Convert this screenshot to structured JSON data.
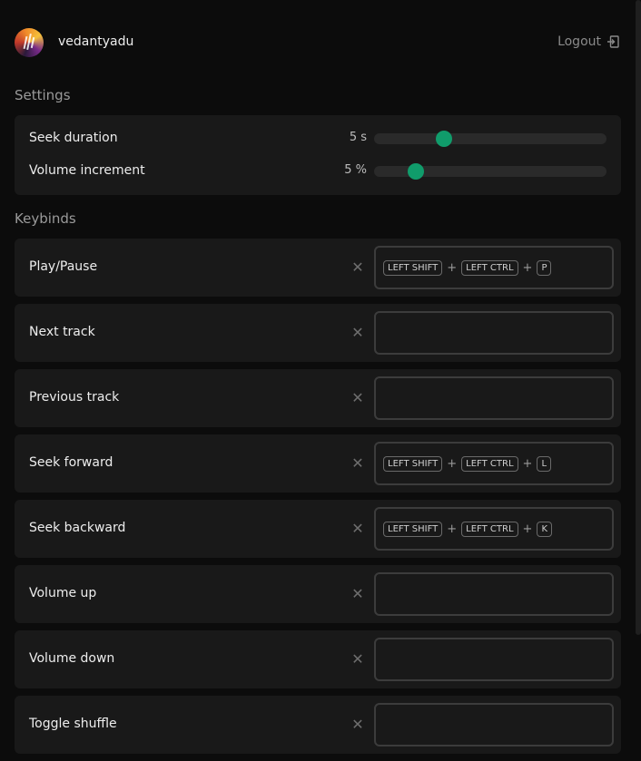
{
  "header": {
    "username": "vedantyadu",
    "logout_label": "Logout"
  },
  "settings": {
    "title": "Settings",
    "items": [
      {
        "label": "Seek duration",
        "value": "5 s",
        "level": 0.3
      },
      {
        "label": "Volume increment",
        "value": "5 %",
        "level": 0.18
      }
    ]
  },
  "keybinds": {
    "title": "Keybinds",
    "items": [
      {
        "label": "Play/Pause",
        "keys": [
          "LEFT SHIFT",
          "LEFT CTRL",
          "P"
        ]
      },
      {
        "label": "Next track",
        "keys": []
      },
      {
        "label": "Previous track",
        "keys": []
      },
      {
        "label": "Seek forward",
        "keys": [
          "LEFT SHIFT",
          "LEFT CTRL",
          "L"
        ]
      },
      {
        "label": "Seek backward",
        "keys": [
          "LEFT SHIFT",
          "LEFT CTRL",
          "K"
        ]
      },
      {
        "label": "Volume up",
        "keys": []
      },
      {
        "label": "Volume down",
        "keys": []
      },
      {
        "label": "Toggle shuffle",
        "keys": []
      }
    ],
    "plus_symbol": "+",
    "clear_symbol": "✕"
  },
  "colors": {
    "accent": "#109c6b",
    "card": "#191919",
    "background": "#0c0c0c"
  }
}
